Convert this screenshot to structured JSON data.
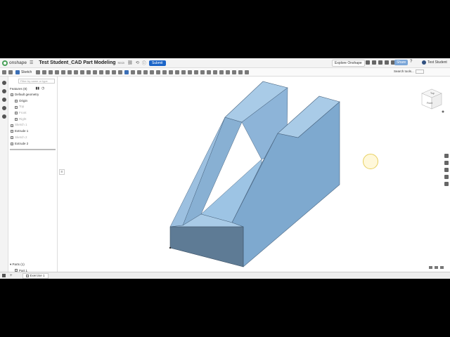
{
  "app": {
    "brand": "onshape",
    "document_title": "Test Student_CAD Part Modeling",
    "document_sub": "Main",
    "submit_label": "Submit",
    "explore_label": "Explore Onshape",
    "share_label": "Share",
    "user_name": "Test Student",
    "help_label": "?"
  },
  "toolbar": {
    "sketch_label": "Sketch",
    "search_tools_label": "Search tools..."
  },
  "feature_panel": {
    "filter_placeholder": "Filter by name or type",
    "features_header": "Features (8)",
    "items": [
      {
        "label": "Default geometry",
        "kind": "group"
      },
      {
        "label": "Origin",
        "kind": "sub"
      },
      {
        "label": "Top",
        "kind": "sub-dim"
      },
      {
        "label": "Front",
        "kind": "sub-dim"
      },
      {
        "label": "Right",
        "kind": "sub-dim"
      },
      {
        "label": "Sketch 1",
        "kind": "dim"
      },
      {
        "label": "Extrude 1",
        "kind": "item"
      },
      {
        "label": "Sketch 2",
        "kind": "dim"
      },
      {
        "label": "Extrude 2",
        "kind": "item"
      }
    ],
    "parts_header": "Parts (1)",
    "parts": [
      "Part 1"
    ]
  },
  "viewcube": {
    "front_label": "Front",
    "top_label": "Top"
  },
  "bottom_bar": {
    "tab_label": "Exercise 1"
  },
  "colors": {
    "model_top": "#a9cbe7",
    "model_side": "#7ea9cf",
    "model_front": "#5e7b95",
    "brand_green": "#4aa15a",
    "submit_blue": "#1a64c8"
  }
}
